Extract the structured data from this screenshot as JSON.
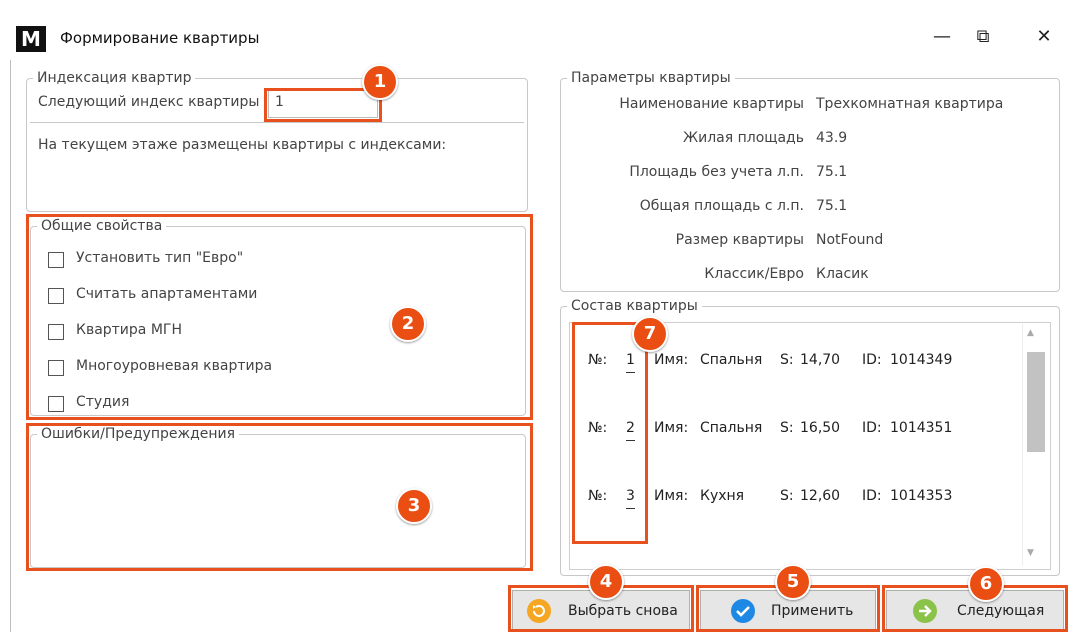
{
  "window": {
    "logo": "M",
    "title": "Формирование квартиры",
    "minimize": "—",
    "restore": "⧉",
    "close": "✕"
  },
  "indexing": {
    "legend": "Индексация квартир",
    "next_index_label": "Следующий индекс квартиры",
    "next_index_value": "1",
    "current_floor_text": "На текущем этаже размещены квартиры с индексами:"
  },
  "general": {
    "legend": "Общие свойства",
    "options": [
      {
        "label": "Установить тип \"Евро\"",
        "checked": false
      },
      {
        "label": "Считать апартаментами",
        "checked": false
      },
      {
        "label": "Квартира МГН",
        "checked": false
      },
      {
        "label": "Многоуровневая квартира",
        "checked": false
      },
      {
        "label": "Студия",
        "checked": false
      }
    ]
  },
  "errors": {
    "legend": "Ошибки/Предупреждения"
  },
  "params": {
    "legend": "Параметры квартиры",
    "rows": [
      {
        "label": "Наименование квартиры",
        "value": "Трехкомнатная квартира"
      },
      {
        "label": "Жилая площадь",
        "value": "43.9"
      },
      {
        "label": "Площадь без учета л.п.",
        "value": "75.1"
      },
      {
        "label": "Общая площадь с л.п.",
        "value": "75.1"
      },
      {
        "label": "Размер квартиры",
        "value": "NotFound"
      },
      {
        "label": "Классик/Евро",
        "value": "Класик"
      }
    ]
  },
  "composition": {
    "legend": "Состав квартиры",
    "rows": [
      {
        "no_label": "№:",
        "no": "1",
        "name_label": "Имя:",
        "name": "Спальня",
        "s_label": "S:",
        "s": "14,70",
        "id_label": "ID:",
        "id": "1014349"
      },
      {
        "no_label": "№:",
        "no": "2",
        "name_label": "Имя:",
        "name": "Спальня",
        "s_label": "S:",
        "s": "16,50",
        "id_label": "ID:",
        "id": "1014351"
      },
      {
        "no_label": "№:",
        "no": "3",
        "name_label": "Имя:",
        "name": "Кухня",
        "s_label": "S:",
        "s": "12,60",
        "id_label": "ID:",
        "id": "1014353"
      }
    ]
  },
  "buttons": {
    "reselect": "Выбрать снова",
    "apply": "Применить",
    "next": "Следующая"
  },
  "badges": [
    "1",
    "2",
    "3",
    "4",
    "5",
    "6",
    "7"
  ],
  "colors": {
    "highlight": "#e8501e",
    "badge": "#ea4e12",
    "reselect_icon": "#f5a623",
    "apply_icon": "#1e88e5",
    "next_icon": "#8bc34a"
  },
  "icons": {
    "reselect": "undo-icon",
    "apply": "check-icon",
    "next": "arrow-right-icon",
    "scroll_up": "▲",
    "scroll_down": "▼"
  }
}
